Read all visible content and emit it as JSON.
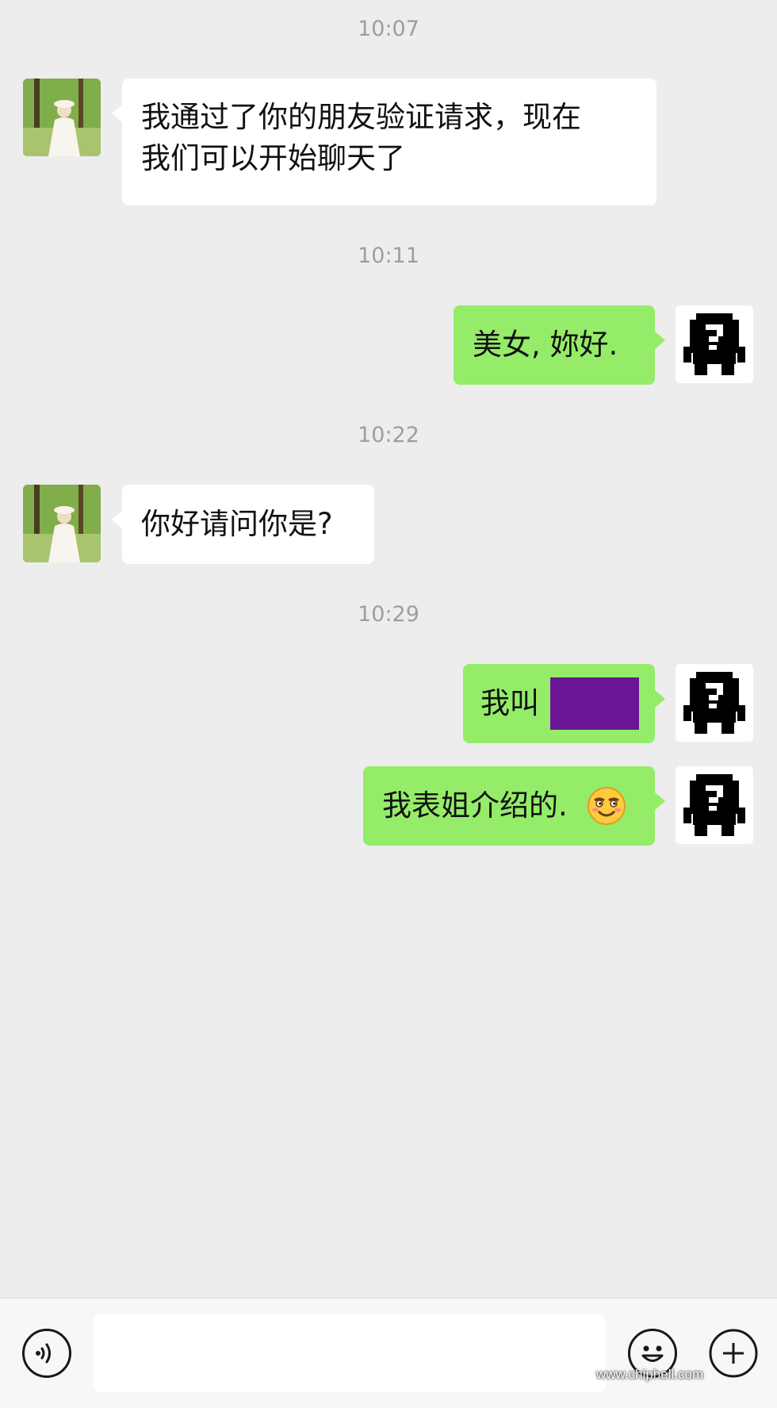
{
  "messages": [
    {
      "time": "10:07",
      "sender": "contact",
      "lines": [
        "我通过了你的朋友验证请求，现在",
        "我们可以开始聊天了"
      ]
    },
    {
      "time": "10:11",
      "sender": "me",
      "text": "美女, 妳好."
    },
    {
      "time": "10:22",
      "sender": "contact",
      "text": "你好请问你是?"
    },
    {
      "time": "10:29",
      "sender": "me",
      "text": "我叫",
      "redacted": true
    },
    {
      "sender": "me",
      "text": "我表姐介绍的.",
      "emoji": "smiling-face-emoji"
    }
  ],
  "input_bar": {
    "voice_icon": "voice-icon",
    "emoji_icon": "emoji-face-icon",
    "more_icon": "plus-icon",
    "input_value": ""
  },
  "watermark": "www.chiphell.com",
  "colors": {
    "background": "#ededed",
    "incoming_bubble": "#ffffff",
    "outgoing_bubble": "#95ec69",
    "redaction": "#6a1696"
  }
}
